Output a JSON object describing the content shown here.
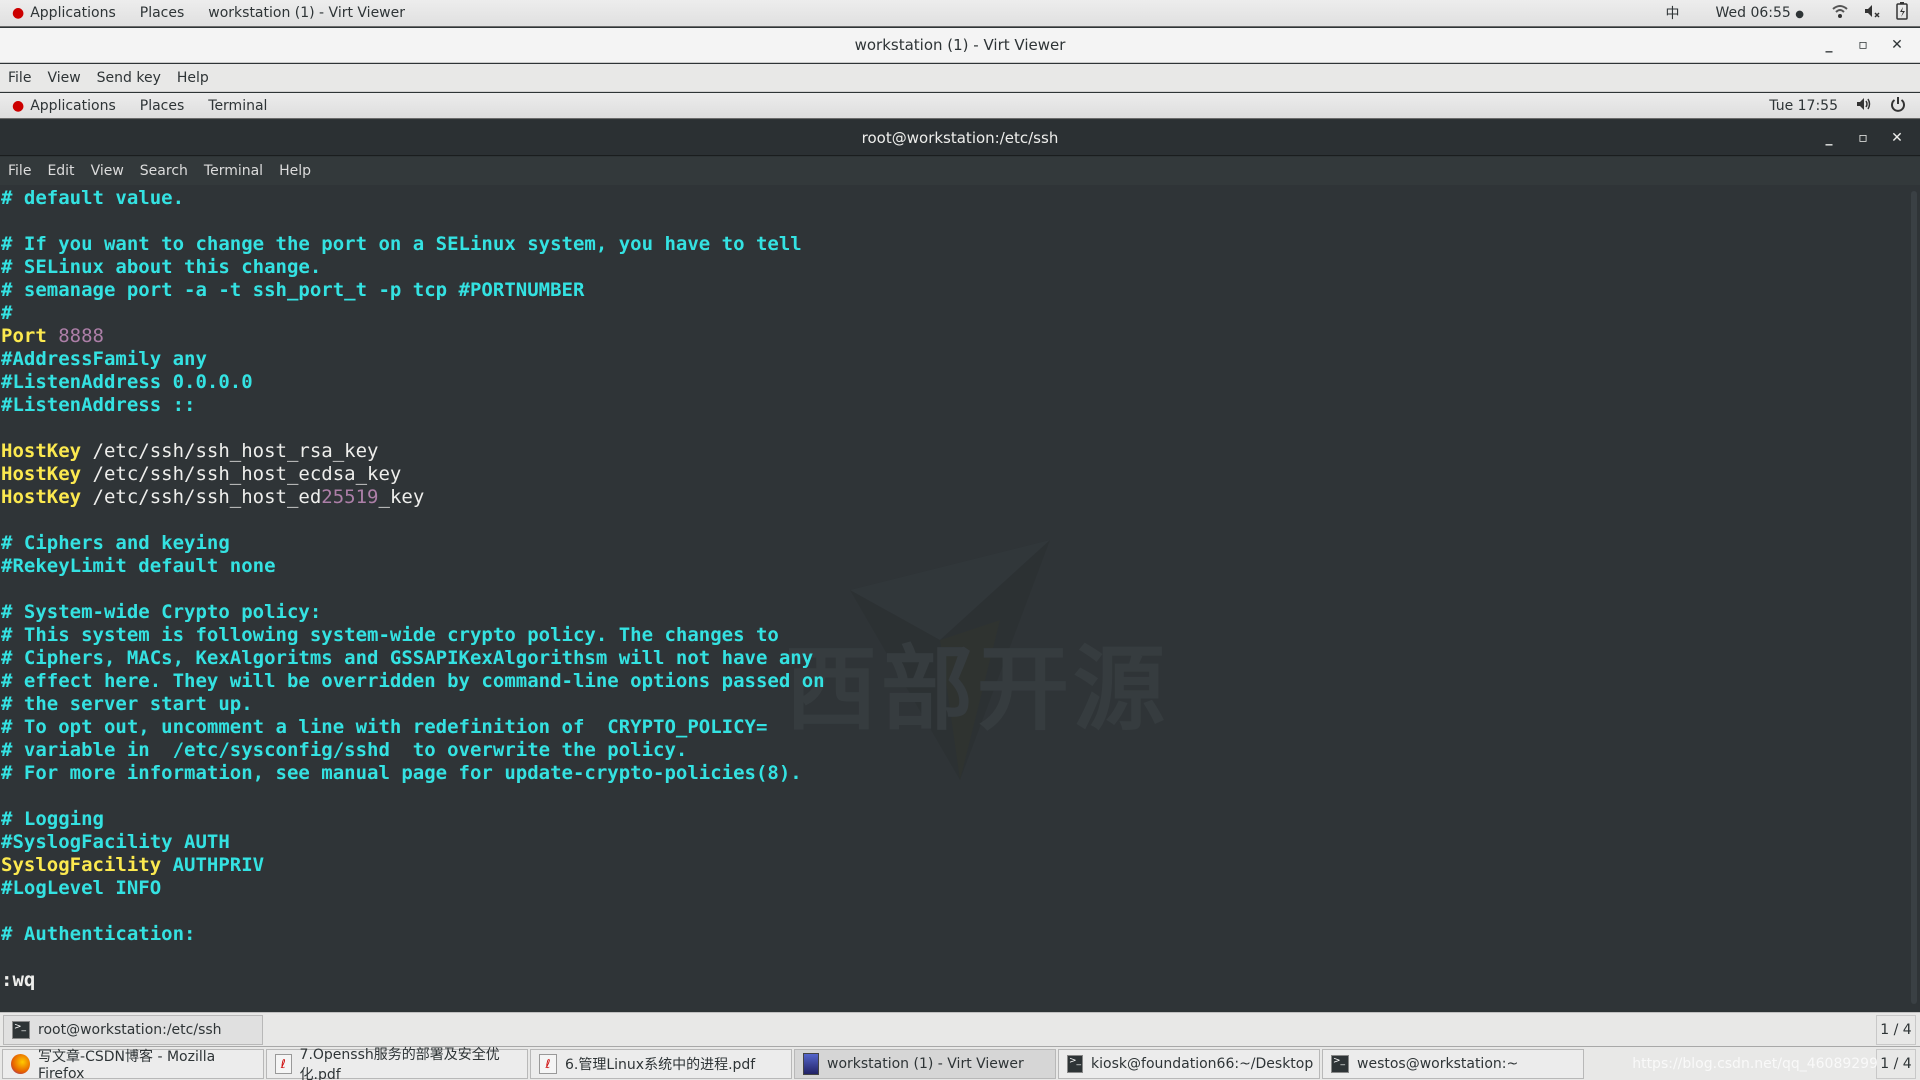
{
  "host_panel": {
    "applications": "Applications",
    "places": "Places",
    "active_window": "workstation (1) - Virt Viewer",
    "input_method": "中",
    "clock": "Wed 06:55",
    "clock_dot": "●"
  },
  "virt_viewer": {
    "title": "workstation (1) - Virt Viewer",
    "menu": [
      "File",
      "View",
      "Send key",
      "Help"
    ],
    "controls": {
      "minimize": "_",
      "maximize": "▫",
      "close": "✕"
    }
  },
  "guest_panel": {
    "applications": "Applications",
    "places": "Places",
    "app": "Terminal",
    "clock": "Tue 17:55"
  },
  "terminal": {
    "title": "root@workstation:/etc/ssh",
    "menu": [
      "File",
      "Edit",
      "View",
      "Search",
      "Terminal",
      "Help"
    ],
    "lines": [
      [
        {
          "t": "# default value.",
          "c": "comment"
        }
      ],
      [],
      [
        {
          "t": "# If you want to change the port on a SELinux system, you have to tell",
          "c": "comment"
        }
      ],
      [
        {
          "t": "# SELinux about this change.",
          "c": "comment"
        }
      ],
      [
        {
          "t": "# semanage port -a -t ssh_port_t -p tcp #PORTNUMBER",
          "c": "comment"
        }
      ],
      [
        {
          "t": "#",
          "c": "comment"
        }
      ],
      [
        {
          "t": "Port",
          "c": "key"
        },
        {
          "t": " ",
          "c": "text"
        },
        {
          "t": "8888",
          "c": "num"
        }
      ],
      [
        {
          "t": "#AddressFamily any",
          "c": "comment"
        }
      ],
      [
        {
          "t": "#ListenAddress 0.0.0.0",
          "c": "comment"
        }
      ],
      [
        {
          "t": "#ListenAddress ::",
          "c": "comment"
        }
      ],
      [],
      [
        {
          "t": "HostKey",
          "c": "key"
        },
        {
          "t": " /etc/ssh/ssh_host_rsa_key",
          "c": "text"
        }
      ],
      [
        {
          "t": "HostKey",
          "c": "key"
        },
        {
          "t": " /etc/ssh/ssh_host_ecdsa_key",
          "c": "text"
        }
      ],
      [
        {
          "t": "HostKey",
          "c": "key"
        },
        {
          "t": " /etc/ssh/ssh_host_ed",
          "c": "text"
        },
        {
          "t": "25519",
          "c": "num"
        },
        {
          "t": "_key",
          "c": "text"
        }
      ],
      [],
      [
        {
          "t": "# Ciphers and keying",
          "c": "comment"
        }
      ],
      [
        {
          "t": "#RekeyLimit default none",
          "c": "comment"
        }
      ],
      [],
      [
        {
          "t": "# System-wide Crypto policy:",
          "c": "comment"
        }
      ],
      [
        {
          "t": "# This system is following system-wide crypto policy. The changes to",
          "c": "comment"
        }
      ],
      [
        {
          "t": "# Ciphers, MACs, KexAlgoritms and GSSAPIKexAlgorithsm will not have any",
          "c": "comment"
        }
      ],
      [
        {
          "t": "# effect here. They will be overridden by command-line options passed on",
          "c": "comment"
        }
      ],
      [
        {
          "t": "# the server start up.",
          "c": "comment"
        }
      ],
      [
        {
          "t": "# To opt out, uncomment a line with redefinition of  CRYPTO_POLICY=",
          "c": "comment"
        }
      ],
      [
        {
          "t": "# variable in  /etc/sysconfig/sshd  to overwrite the policy.",
          "c": "comment"
        }
      ],
      [
        {
          "t": "# For more information, see manual page for update-crypto-policies(8).",
          "c": "comment"
        }
      ],
      [],
      [
        {
          "t": "# Logging",
          "c": "comment"
        }
      ],
      [
        {
          "t": "#SyslogFacility AUTH",
          "c": "comment"
        }
      ],
      [
        {
          "t": "SyslogFacility",
          "c": "key"
        },
        {
          "t": " ",
          "c": "text"
        },
        {
          "t": "AUTHPRIV",
          "c": "cyan"
        }
      ],
      [
        {
          "t": "#LogLevel INFO",
          "c": "comment"
        }
      ],
      [],
      [
        {
          "t": "# Authentication:",
          "c": "comment"
        }
      ],
      [],
      [
        {
          "t": ":wq",
          "c": "cmd"
        }
      ]
    ],
    "watermark_text": "西部开源"
  },
  "guest_taskbar": {
    "tasks": [
      {
        "label": "root@workstation:/etc/ssh",
        "icon": "terminal-icon"
      }
    ],
    "pager": "1 / 4"
  },
  "host_taskbar": {
    "tasks": [
      {
        "label": "写文章-CSDN博客 - Mozilla Firefox",
        "icon": "firefox-icon"
      },
      {
        "label": "7.Openssh服务的部署及安全优化.pdf",
        "icon": "pdf-icon"
      },
      {
        "label": "6.管理Linux系统中的进程.pdf",
        "icon": "pdf-icon"
      },
      {
        "label": "workstation (1) - Virt Viewer",
        "icon": "virt-viewer-icon",
        "active": true
      },
      {
        "label": "kiosk@foundation66:~/Desktop",
        "icon": "terminal-icon"
      },
      {
        "label": "westos@workstation:~",
        "icon": "terminal-icon"
      }
    ],
    "url_watermark": "https://blog.csdn.net/qq_46089299",
    "pager": "1 / 4"
  }
}
